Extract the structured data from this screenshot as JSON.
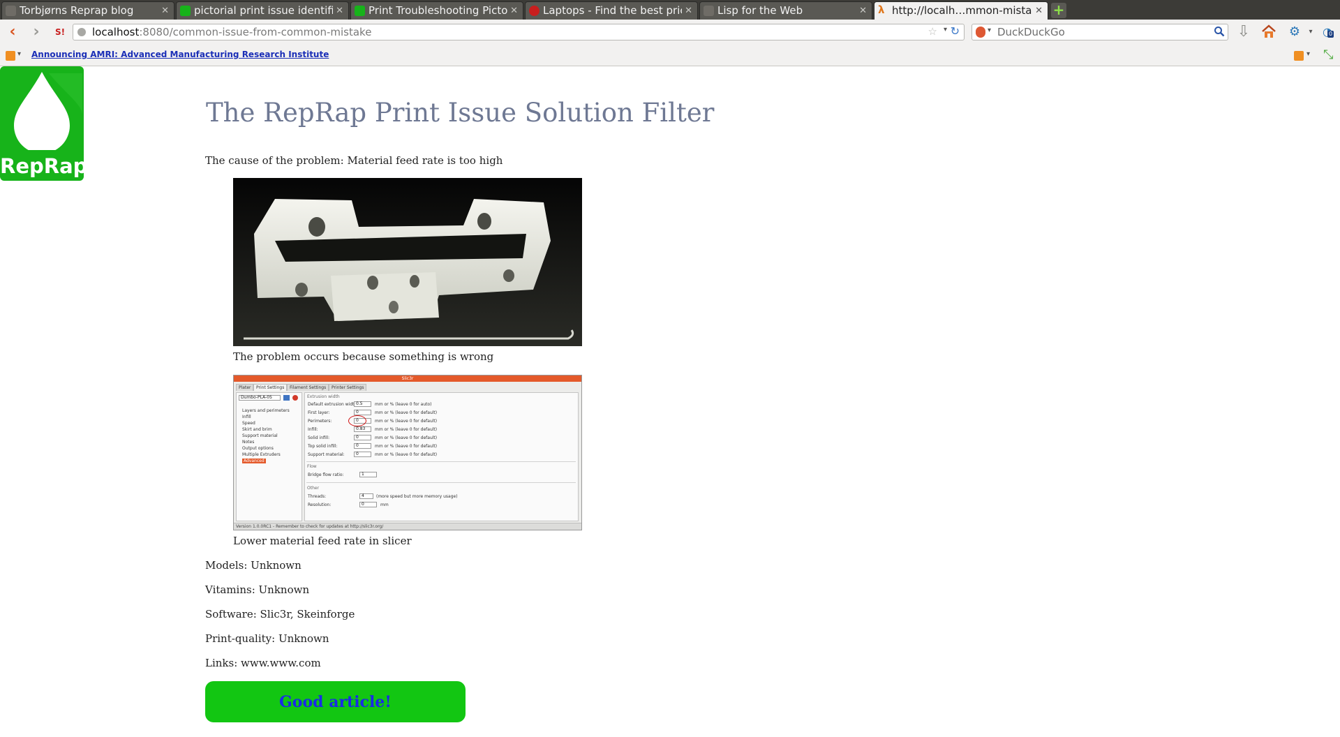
{
  "browser": {
    "tabs": [
      {
        "title": "Torbjørns Reprap blog",
        "favicon": "blog-favicon",
        "active": false
      },
      {
        "title": "pictorial print issue identifier",
        "favicon": "reprap-favicon",
        "active": false
      },
      {
        "title": "Print Troubleshooting Picto…",
        "favicon": "reprap-favicon",
        "active": false
      },
      {
        "title": "Laptops - Find the best pric…",
        "favicon": "store-favicon",
        "active": false
      },
      {
        "title": "Lisp for the Web",
        "favicon": "blank-favicon",
        "active": false
      },
      {
        "title": "http://localh…mmon-mistake",
        "favicon": "lambda-favicon",
        "active": true
      }
    ],
    "url": {
      "host": "localhost",
      "path": ":8080/common-issue-from-common-mistake"
    },
    "search_placeholder": "DuckDuckGo",
    "download_count": "0",
    "bookmark_link": "Announcing AMRI: Advanced Manufacturing Research Institute",
    "colors": {
      "accent": "#d9531e",
      "tab_strip": "#3c3b37",
      "toolbar": "#f2f1f0",
      "link": "#1b2fb7"
    }
  },
  "page": {
    "logo_text": "RepRap",
    "title": "The RepRap Print Issue Solution Filter",
    "cause_line": "The cause of the problem: Material feed rate is too high",
    "problem_caption": "The problem occurs because something is wrong",
    "solution_caption": "Lower material feed rate in slicer",
    "models": "Models: Unknown",
    "vitamins": "Vitamins: Unknown",
    "software": "Software: Slic3r, Skeinforge",
    "print_quality": "Print-quality: Unknown",
    "links": "Links: www.www.com",
    "good_button": "Good article!",
    "colors": {
      "title": "#6e7893",
      "button_bg": "#12c612",
      "button_text": "#1a2be6",
      "logo_bg": "#17b31a"
    }
  },
  "slicer_screenshot": {
    "window_title": "Slic3r",
    "tabs": [
      "Plater",
      "Print Settings",
      "Filament Settings",
      "Printer Settings"
    ],
    "profile": "Dumbo-PLA-05",
    "tree": [
      "Layers and perimeters",
      "Infill",
      "Speed",
      "Skirt and brim",
      "Support material",
      "Notes",
      "Output options",
      "Multiple Extruders",
      "Advanced"
    ],
    "section_extrusion": "Extrusion width",
    "rows": [
      {
        "label": "Default extrusion width:",
        "value": "0.5",
        "hint": "mm or % (leave 0 for auto)"
      },
      {
        "label": "First layer:",
        "value": "0",
        "hint": "mm or % (leave 0 for default)"
      },
      {
        "label": "Perimeters:",
        "value": "0",
        "hint": "mm or % (leave 0 for default)"
      },
      {
        "label": "Infill:",
        "value": "0.83",
        "hint": "mm or % (leave 0 for default)"
      },
      {
        "label": "Solid infill:",
        "value": "0",
        "hint": "mm or % (leave 0 for default)"
      },
      {
        "label": "Top solid infill:",
        "value": "0",
        "hint": "mm or % (leave 0 for default)"
      },
      {
        "label": "Support material:",
        "value": "0",
        "hint": "mm or % (leave 0 for default)"
      }
    ],
    "section_flow": "Flow",
    "bridge_label": "Bridge flow ratio:",
    "bridge_value": "1",
    "section_other": "Other",
    "threads_label": "Threads:",
    "threads_value": "4",
    "threads_hint": "(more speed but more memory usage)",
    "resolution_label": "Resolution:",
    "resolution_value": "0",
    "resolution_unit": "mm",
    "status": "Version 1.0.0RC1 - Remember to check for updates at http://slic3r.org/"
  }
}
